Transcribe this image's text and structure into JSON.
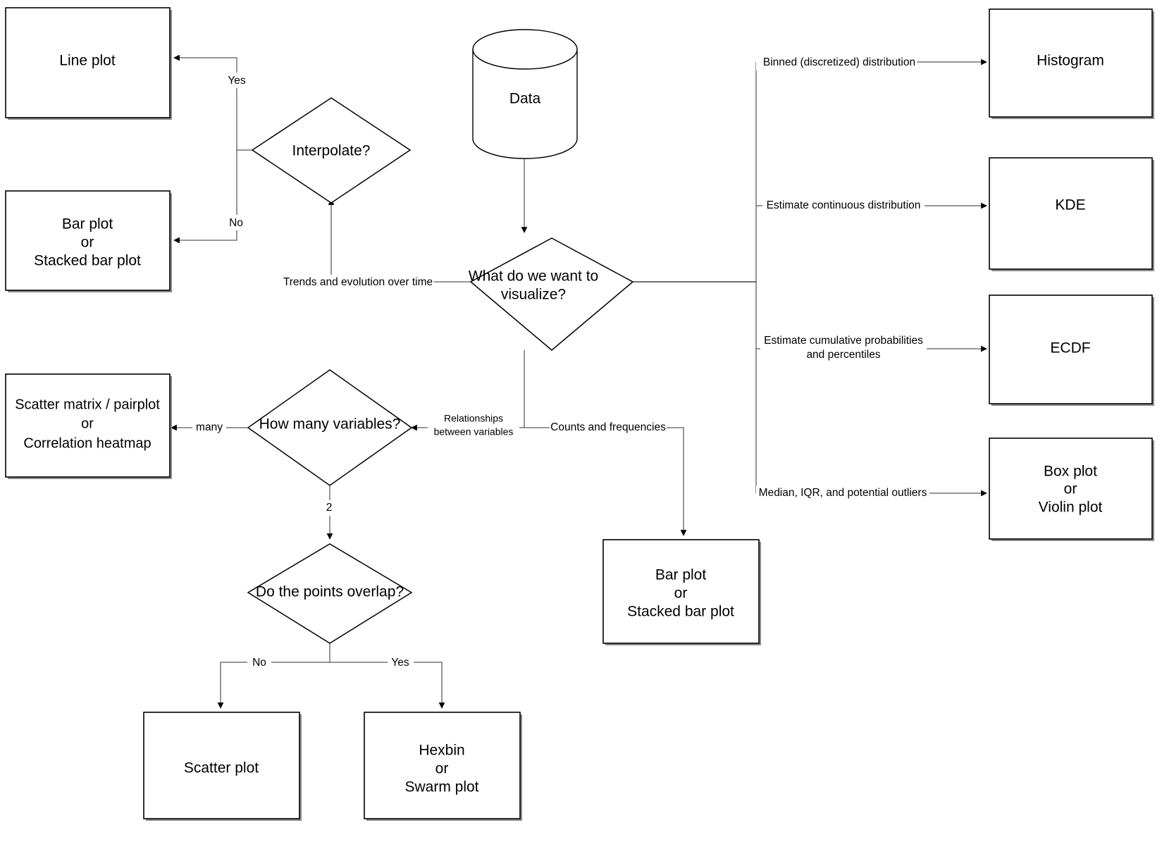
{
  "diagram": {
    "title": "Data visualization selection flowchart",
    "type": "flowchart",
    "colors": {
      "box_stroke": "#000000",
      "connector": "#595959",
      "shadow": "#8c8c8c",
      "background": "#ffffff",
      "text": "#000000"
    }
  },
  "nodes": {
    "data_source": {
      "label": "Data",
      "shape": "cylinder"
    },
    "what_visualize": {
      "line1": "What do we want to",
      "line2": "visualize?",
      "shape": "diamond"
    },
    "interpolate": {
      "label": "Interpolate?",
      "shape": "diamond"
    },
    "how_many_variables": {
      "label": "How many variables?",
      "shape": "diamond"
    },
    "points_overlap": {
      "label": "Do the points overlap?",
      "shape": "diamond"
    },
    "line_plot": {
      "label": "Line plot",
      "shape": "box"
    },
    "bar_plot_left": {
      "line1": "Bar plot",
      "line2": "or",
      "line3": "Stacked bar plot",
      "shape": "box"
    },
    "scatter_matrix": {
      "line1": "Scatter matrix / pairplot",
      "line2": "or",
      "line3": "Correlation heatmap",
      "shape": "box"
    },
    "scatter_plot": {
      "label": "Scatter plot",
      "shape": "box"
    },
    "hexbin": {
      "line1": "Hexbin",
      "line2": "or",
      "line3": "Swarm plot",
      "shape": "box"
    },
    "bar_plot_counts": {
      "line1": "Bar plot",
      "line2": "or",
      "line3": "Stacked bar plot",
      "shape": "box"
    },
    "histogram": {
      "label": "Histogram",
      "shape": "box"
    },
    "kde": {
      "label": "KDE",
      "shape": "box"
    },
    "ecdf": {
      "label": "ECDF",
      "shape": "box"
    },
    "box_violin": {
      "line1": "Box plot",
      "line2": "or",
      "line3": "Violin plot",
      "shape": "box"
    }
  },
  "edge_labels": {
    "yes_interpolate": "Yes",
    "no_interpolate": "No",
    "trends": "Trends and evolution over time",
    "binned": "Binned (discretized) distribution",
    "continuous": "Estimate continuous distribution",
    "cumulative_line1": "Estimate cumulative probabilities",
    "cumulative_line2": "and percentiles",
    "median_iqr": "Median, IQR, and potential outliers",
    "relationships_line1": "Relationships",
    "relationships_line2": "between variables",
    "counts": "Counts and frequencies",
    "many": "many",
    "two": "2",
    "no_overlap": "No",
    "yes_overlap": "Yes"
  }
}
